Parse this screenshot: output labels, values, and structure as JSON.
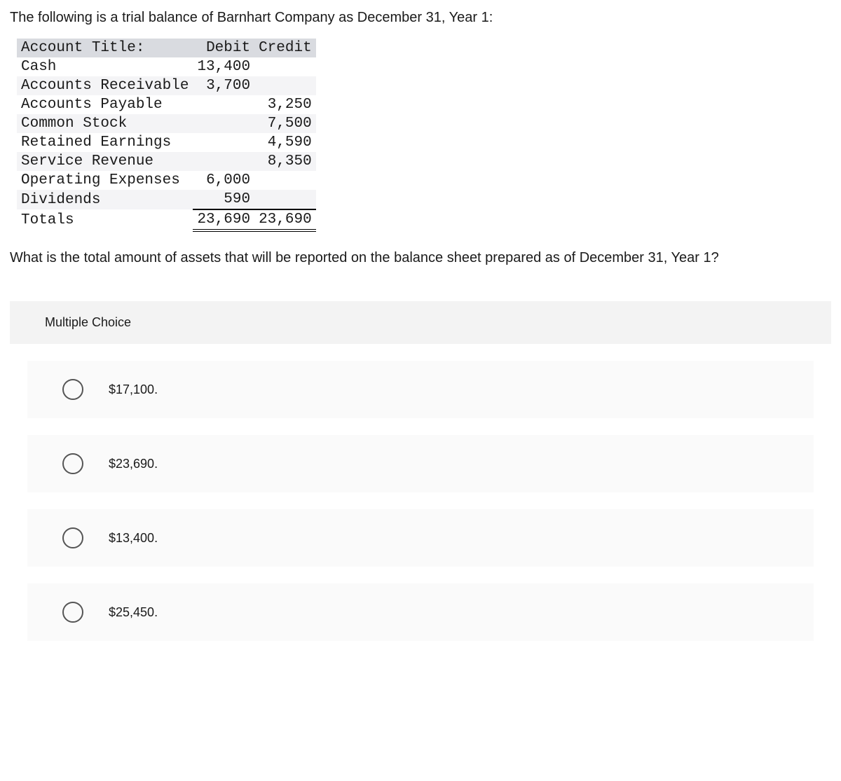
{
  "intro": "The following is a trial balance of Barnhart Company as December 31, Year 1:",
  "headers": {
    "account": "Account Title:",
    "debit": "Debit",
    "credit": "Credit"
  },
  "rows": [
    {
      "title": "Cash",
      "debit": "13,400",
      "credit": ""
    },
    {
      "title": "Accounts Receivable",
      "debit": "3,700",
      "credit": ""
    },
    {
      "title": "Accounts Payable",
      "debit": "",
      "credit": "3,250"
    },
    {
      "title": "Common Stock",
      "debit": "",
      "credit": "7,500"
    },
    {
      "title": "Retained Earnings",
      "debit": "",
      "credit": "4,590"
    },
    {
      "title": "Service Revenue",
      "debit": "",
      "credit": "8,350"
    },
    {
      "title": "Operating Expenses",
      "debit": "6,000",
      "credit": ""
    },
    {
      "title": "Dividends",
      "debit": "590",
      "credit": ""
    }
  ],
  "totals": {
    "label": "Totals",
    "debit": "23,690",
    "credit": "23,690"
  },
  "question": "What is the total amount of assets that will be reported on the balance sheet prepared as of December 31, Year 1?",
  "mc_label": "Multiple Choice",
  "options": [
    "$17,100.",
    "$23,690.",
    "$13,400.",
    "$25,450."
  ]
}
